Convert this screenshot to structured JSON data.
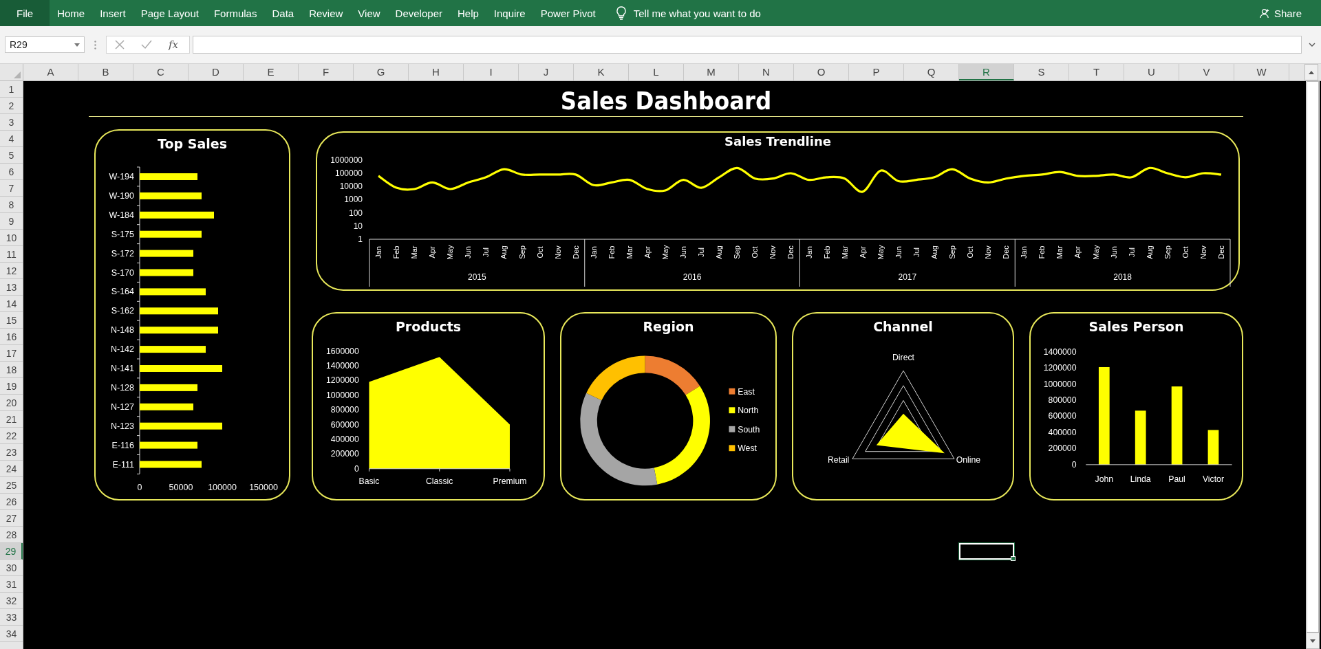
{
  "ribbon": {
    "file_tab": "File",
    "tabs": [
      "Home",
      "Insert",
      "Page Layout",
      "Formulas",
      "Data",
      "Review",
      "View",
      "Developer",
      "Help",
      "Inquire",
      "Power Pivot"
    ],
    "tell_me": "Tell me what you want to do",
    "share": "Share"
  },
  "formula_bar": {
    "name_box": "R29",
    "function_label": "fx"
  },
  "columns": [
    {
      "label": "A",
      "selected": false
    },
    {
      "label": "B",
      "selected": false
    },
    {
      "label": "C",
      "selected": false
    },
    {
      "label": "D",
      "selected": false
    },
    {
      "label": "E",
      "selected": false
    },
    {
      "label": "F",
      "selected": false
    },
    {
      "label": "G",
      "selected": false
    },
    {
      "label": "H",
      "selected": false
    },
    {
      "label": "I",
      "selected": false
    },
    {
      "label": "J",
      "selected": false
    },
    {
      "label": "K",
      "selected": false
    },
    {
      "label": "L",
      "selected": false
    },
    {
      "label": "M",
      "selected": false
    },
    {
      "label": "N",
      "selected": false
    },
    {
      "label": "O",
      "selected": false
    },
    {
      "label": "P",
      "selected": false
    },
    {
      "label": "Q",
      "selected": false
    },
    {
      "label": "R",
      "selected": true
    },
    {
      "label": "S",
      "selected": false
    },
    {
      "label": "T",
      "selected": false
    },
    {
      "label": "U",
      "selected": false
    },
    {
      "label": "V",
      "selected": false
    },
    {
      "label": "W",
      "selected": false
    }
  ],
  "rows": [
    {
      "label": "1",
      "selected": false
    },
    {
      "label": "2",
      "selected": false
    },
    {
      "label": "3",
      "selected": false
    },
    {
      "label": "4",
      "selected": false
    },
    {
      "label": "5",
      "selected": false
    },
    {
      "label": "6",
      "selected": false
    },
    {
      "label": "7",
      "selected": false
    },
    {
      "label": "8",
      "selected": false
    },
    {
      "label": "9",
      "selected": false
    },
    {
      "label": "10",
      "selected": false
    },
    {
      "label": "11",
      "selected": false
    },
    {
      "label": "12",
      "selected": false
    },
    {
      "label": "13",
      "selected": false
    },
    {
      "label": "14",
      "selected": false
    },
    {
      "label": "15",
      "selected": false
    },
    {
      "label": "16",
      "selected": false
    },
    {
      "label": "17",
      "selected": false
    },
    {
      "label": "18",
      "selected": false
    },
    {
      "label": "19",
      "selected": false
    },
    {
      "label": "20",
      "selected": false
    },
    {
      "label": "21",
      "selected": false
    },
    {
      "label": "22",
      "selected": false
    },
    {
      "label": "23",
      "selected": false
    },
    {
      "label": "24",
      "selected": false
    },
    {
      "label": "25",
      "selected": false
    },
    {
      "label": "26",
      "selected": false
    },
    {
      "label": "27",
      "selected": false
    },
    {
      "label": "28",
      "selected": false
    },
    {
      "label": "29",
      "selected": true
    },
    {
      "label": "30",
      "selected": false
    },
    {
      "label": "31",
      "selected": false
    },
    {
      "label": "32",
      "selected": false
    },
    {
      "label": "33",
      "selected": false
    },
    {
      "label": "34",
      "selected": false
    }
  ],
  "dashboard": {
    "title": "Sales Dashboard",
    "top_sales": {
      "title": "Top Sales",
      "chart_data": {
        "type": "bar",
        "orientation": "horizontal",
        "categories": [
          "W-194",
          "W-190",
          "W-184",
          "S-175",
          "S-172",
          "S-170",
          "S-164",
          "S-162",
          "N-148",
          "N-142",
          "N-141",
          "N-128",
          "N-127",
          "N-123",
          "E-116",
          "E-111"
        ],
        "values": [
          70000,
          75000,
          90000,
          75000,
          65000,
          65000,
          80000,
          95000,
          95000,
          80000,
          100000,
          70000,
          65000,
          100000,
          70000,
          75000
        ],
        "xlim": [
          0,
          150000
        ],
        "xticks": [
          0,
          50000,
          100000,
          150000
        ]
      }
    },
    "sales_trendline": {
      "title": "Sales Trendline",
      "years": [
        "2015",
        "2016",
        "2017",
        "2018"
      ],
      "months": [
        "Jan",
        "Feb",
        "Mar",
        "Apr",
        "May",
        "Jun",
        "Jul",
        "Aug",
        "Sep",
        "Oct",
        "Nov",
        "Dec",
        "Jan",
        "Feb",
        "Mar",
        "Apr",
        "May",
        "Jun",
        "Jul",
        "Aug",
        "Sep",
        "Oct",
        "Nov",
        "Dec",
        "Jan",
        "Feb",
        "Mar",
        "Apr",
        "May",
        "Jun",
        "Jul",
        "Aug",
        "Sep",
        "Oct",
        "Nov",
        "Dec",
        "Jan",
        "Feb",
        "Mar",
        "Apr",
        "May",
        "Jun",
        "Jul",
        "Aug",
        "Sep",
        "Oct",
        "Nov",
        "Dec"
      ],
      "y_axis_labels": [
        "1000000",
        "100000",
        "10000",
        "1000",
        "100",
        "10",
        "1"
      ]
    },
    "products": {
      "title": "Products",
      "chart_data": {
        "type": "area",
        "categories": [
          "Basic",
          "Classic",
          "Premium"
        ],
        "values": [
          1180000,
          1520000,
          600000
        ],
        "ylim": [
          0,
          1600000
        ],
        "yticks": [
          0,
          200000,
          400000,
          600000,
          800000,
          1000000,
          1200000,
          1400000,
          1600000
        ]
      }
    },
    "region": {
      "title": "Region",
      "chart_data": {
        "type": "donut",
        "categories": [
          "East",
          "North",
          "South",
          "West"
        ],
        "values": [
          16,
          31,
          35,
          18
        ],
        "colors": [
          "#ed7d31",
          "#ffff00",
          "#a5a5a5",
          "#ffc000"
        ],
        "legend": "right"
      }
    },
    "channel": {
      "title": "Channel",
      "axes": [
        "Direct",
        "Online",
        "Retail"
      ]
    },
    "sales_person": {
      "title": "Sales Person",
      "chart_data": {
        "type": "bar",
        "categories": [
          "John",
          "Linda",
          "Paul",
          "Victor"
        ],
        "values": [
          1210000,
          670000,
          970000,
          430000
        ],
        "ylim": [
          0,
          1400000
        ],
        "yticks": [
          0,
          200000,
          400000,
          600000,
          800000,
          1000000,
          1200000,
          1400000
        ]
      }
    }
  }
}
